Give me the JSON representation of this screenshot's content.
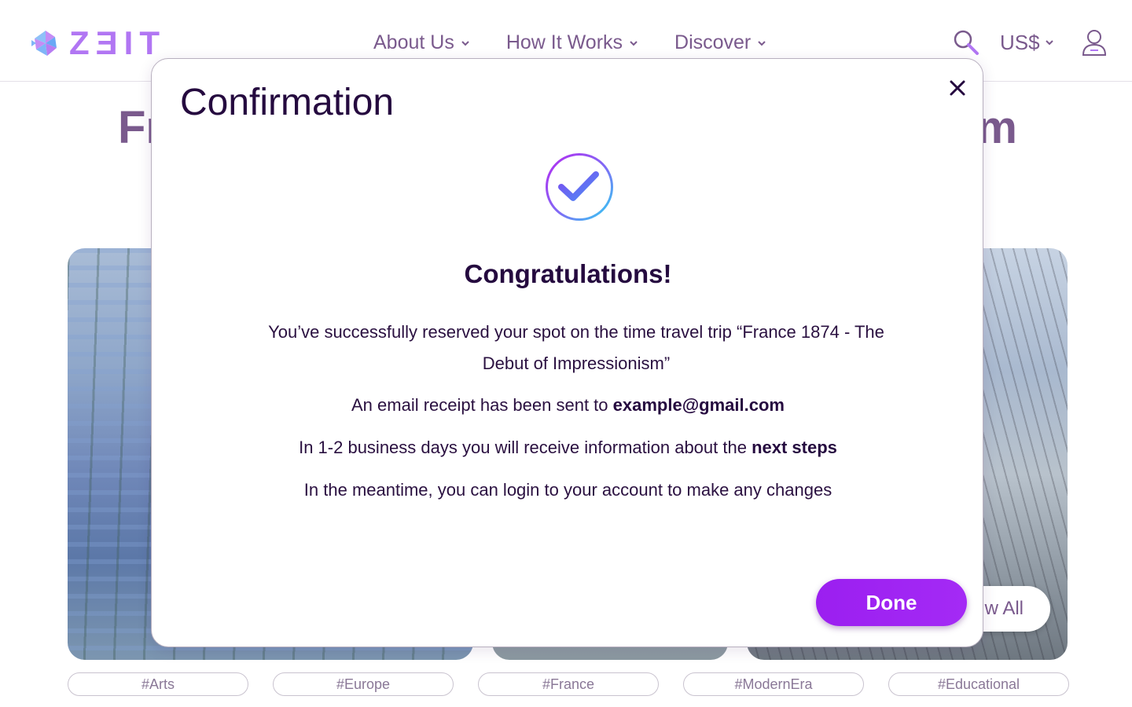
{
  "header": {
    "logo_text": "ZƎIT",
    "nav": [
      {
        "label": "About Us"
      },
      {
        "label": "How It Works"
      },
      {
        "label": "Discover"
      }
    ],
    "currency": "US$"
  },
  "page": {
    "title_left": "Fr",
    "title_right": "m",
    "view_all_label": "w All",
    "tags": [
      "#Arts",
      "#Europe",
      "#France",
      "#ModernEra",
      "#Educational"
    ]
  },
  "modal": {
    "title": "Confirmation",
    "heading": "Congratulations!",
    "reservation_text": "You’ve successfully reserved your spot on the time travel trip “France 1874 - The Debut of Impressionism”",
    "email_prefix": "An email receipt has been sent to ",
    "email": "example@gmail.com",
    "info_prefix": "In 1-2 business days you will receive information about the ",
    "info_bold": "next steps",
    "meantime_text": "In the meantime, you can login to your account to make any changes",
    "done_label": "Done"
  },
  "colors": {
    "accent": "#9b1ff0",
    "logo": "#b176f3",
    "nav_text": "#7a5a8d",
    "heading_text": "#250a3f"
  },
  "icons": {
    "logo": "zeit-logo-icon",
    "search": "search-icon",
    "user": "user-icon",
    "close": "close-icon",
    "check": "check-circle-icon",
    "chevron": "chevron-down-icon"
  }
}
